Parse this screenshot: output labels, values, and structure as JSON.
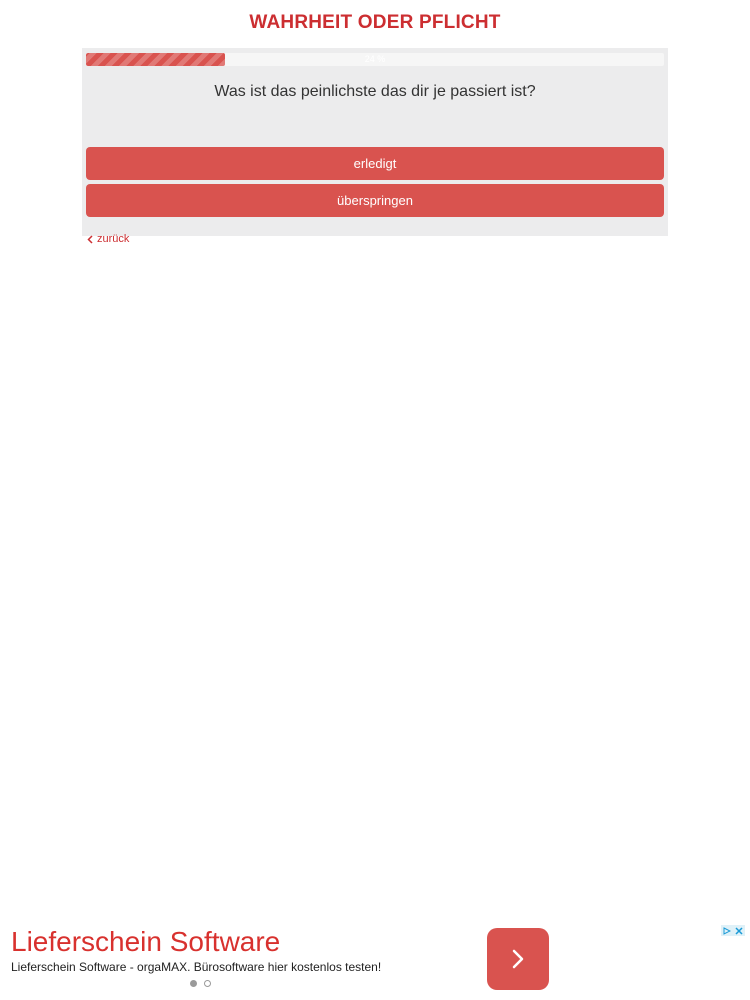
{
  "header": {
    "title": "WAHRHEIT ODER PFLICHT"
  },
  "progress": {
    "label": "24 %",
    "value": 0.24
  },
  "question": {
    "text": "Was ist das peinlichste das dir je passiert ist?"
  },
  "actions": {
    "done_label": "erledigt",
    "skip_label": "überspringen"
  },
  "navigation": {
    "back_label": "zurück",
    "back_icon": "chevron-left-icon"
  },
  "ad": {
    "headline": "Lieferschein Software",
    "text": "Lieferschein Software - orgaMAX. Bürosoftware hier kostenlos testen!",
    "arrow_icon": "chevron-right-icon",
    "choices_icon": "ad-choices-icon",
    "pages": 2,
    "active_page": 1
  },
  "colors": {
    "accent": "#cc2e31",
    "button": "#d9534f",
    "ad_headline": "#d8312e",
    "ad_button": "#d9534f"
  }
}
